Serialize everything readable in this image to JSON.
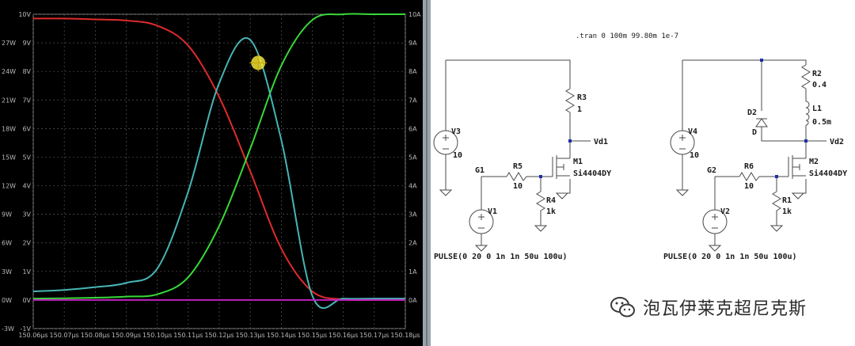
{
  "chart_data": {
    "type": "line",
    "x": [
      "150.06µs",
      "150.07µs",
      "150.08µs",
      "150.09µs",
      "150.10µs",
      "150.11µs",
      "150.12µs",
      "150.13µs",
      "150.14µs",
      "150.15µs",
      "150.16µs",
      "150.17µs",
      "150.18µs"
    ],
    "left_axis_ticks": [
      "-3W",
      "0W",
      "3W",
      "6W",
      "9W",
      "12W",
      "15W",
      "18W",
      "21W",
      "24W",
      "27W"
    ],
    "middle_axis_ticks": [
      "-1V",
      "0V",
      "1V",
      "2V",
      "3V",
      "4V",
      "5V",
      "6V",
      "7V",
      "8V",
      "9V",
      "10V"
    ],
    "right_axis_ticks": [
      "0A",
      "1A",
      "2A",
      "3A",
      "4A",
      "5A",
      "6A",
      "7A",
      "8A",
      "9A",
      "10A"
    ],
    "series": [
      {
        "color": "#e02b2b",
        "values": [
          9.85,
          9.85,
          9.82,
          9.78,
          9.6,
          8.9,
          7.1,
          4.5,
          1.8,
          0.3,
          0.02,
          0.0,
          0.0
        ]
      },
      {
        "color": "#38d838",
        "values": [
          0.05,
          0.06,
          0.08,
          0.12,
          0.2,
          0.8,
          2.6,
          5.3,
          8.2,
          9.8,
          10.0,
          10.0,
          10.0
        ]
      },
      {
        "color": "#47b5b5",
        "values": [
          0.3,
          0.35,
          0.45,
          0.6,
          1.1,
          3.8,
          7.6,
          9.1,
          5.6,
          0.15,
          0.05,
          0.05,
          0.05
        ]
      },
      {
        "color": "#c020c0",
        "values": [
          0.0,
          0.0,
          0.0,
          0.0,
          0.0,
          0.0,
          0.0,
          0.0,
          0.0,
          0.0,
          0.0,
          0.0,
          0.0
        ]
      }
    ],
    "cursor": {
      "color": "#f2e23a"
    }
  },
  "schematic": {
    "directive": ".tran 0 100m 99.80m 1e-7",
    "left": {
      "v3": {
        "name": "V3",
        "value": "10"
      },
      "r3": {
        "name": "R3",
        "value": "1"
      },
      "vd1": "Vd1",
      "m1": {
        "name": "M1",
        "model": "Si4404DY"
      },
      "g1": "G1",
      "r5": {
        "name": "R5",
        "value": "10"
      },
      "r4": {
        "name": "R4",
        "value": "1k"
      },
      "v1": {
        "name": "V1",
        "value": "PULSE(0 20 0 1n 1n 50u 100u)"
      }
    },
    "right": {
      "v4": {
        "name": "V4",
        "value": "10"
      },
      "r2": {
        "name": "R2",
        "value": "0.4"
      },
      "l1": {
        "name": "L1",
        "value": "0.5m"
      },
      "d2": {
        "name": "D2",
        "value": "D"
      },
      "vd2": "Vd2",
      "m2": {
        "name": "M2",
        "model": "Si4404DY"
      },
      "g2": "G2",
      "r6": {
        "name": "R6",
        "value": "10"
      },
      "r1": {
        "name": "R1",
        "value": "1k"
      },
      "v2": {
        "name": "V2",
        "value": "PULSE(0 20 0 1n 1n 50u 100u)"
      }
    }
  },
  "watermark": {
    "text": "泡瓦伊莱克超尼克斯",
    "icon": "wechat-icon"
  }
}
